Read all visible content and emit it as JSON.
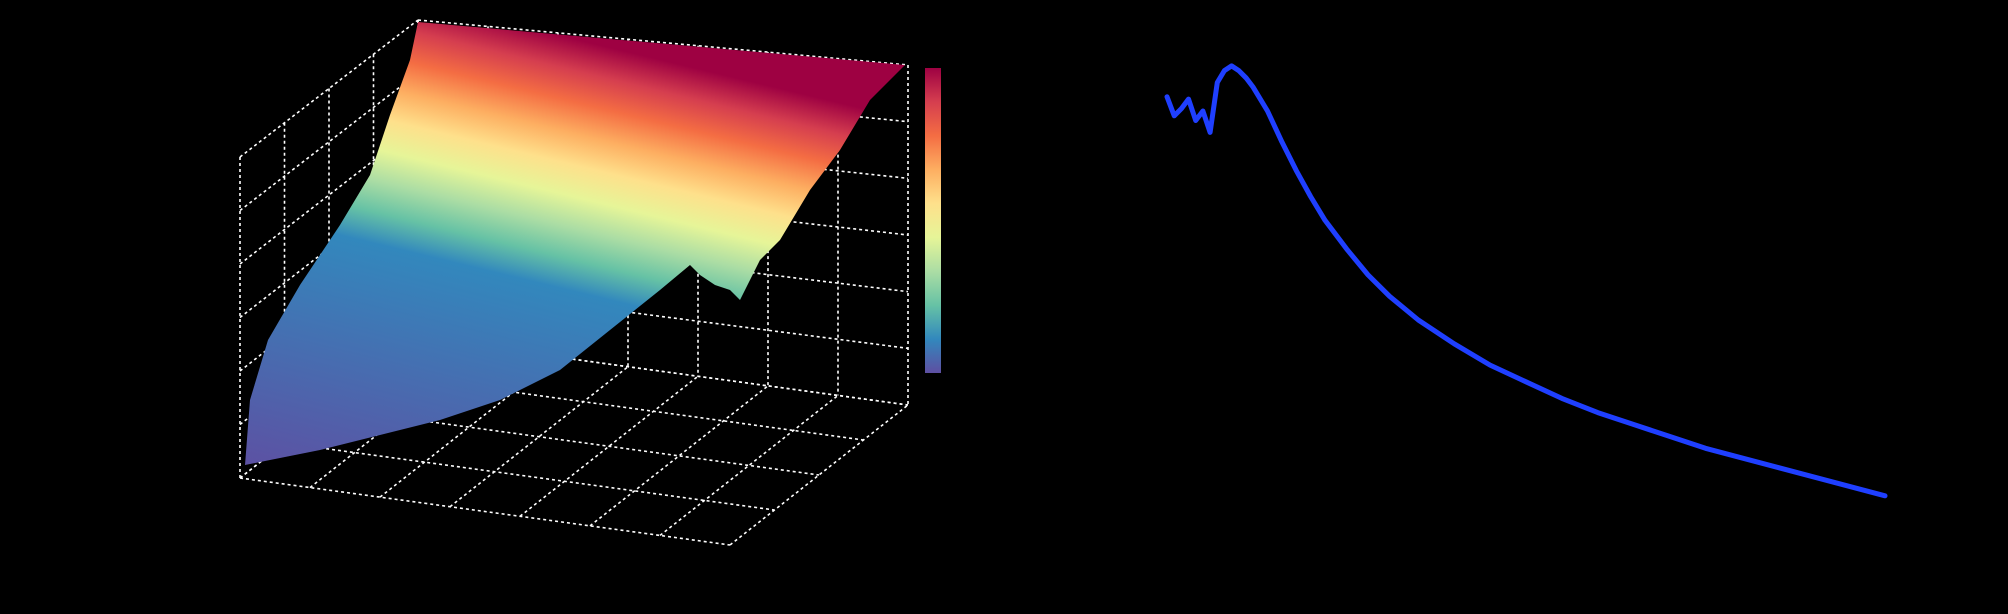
{
  "background": "#000000",
  "chart_data": [
    {
      "type": "surface3d",
      "title": "",
      "xlabel": "",
      "ylabel": "",
      "zlabel": "",
      "colormap": "Spectral_r",
      "colormap_stops": [
        "#5e4fa2",
        "#3288bd",
        "#66c2a5",
        "#abdda4",
        "#e6f598",
        "#fee08b",
        "#fdae61",
        "#f46d43",
        "#d53e4f",
        "#9e0142"
      ],
      "value_range": [
        0,
        1
      ],
      "grid": true,
      "grid_color": "#ffffff",
      "grid_style": "dashed",
      "colorbar": true,
      "colorbar_position": "right"
    },
    {
      "type": "line",
      "title": "",
      "xlabel": "",
      "ylabel": "",
      "xlim": [
        0,
        100
      ],
      "ylim": [
        0,
        1
      ],
      "grid": false,
      "series": [
        {
          "color": "#1f3fff",
          "x": [
            0,
            1,
            2,
            3,
            4,
            5,
            6,
            7,
            8,
            9,
            10,
            11,
            12,
            14,
            16,
            18,
            20,
            22,
            25,
            28,
            31,
            35,
            40,
            45,
            50,
            55,
            60,
            65,
            70,
            75,
            80,
            85,
            90,
            95,
            100
          ],
          "y": [
            0.87,
            0.83,
            0.845,
            0.865,
            0.82,
            0.84,
            0.795,
            0.9,
            0.925,
            0.935,
            0.925,
            0.91,
            0.89,
            0.84,
            0.775,
            0.715,
            0.66,
            0.61,
            0.55,
            0.495,
            0.45,
            0.4,
            0.35,
            0.305,
            0.27,
            0.235,
            0.205,
            0.18,
            0.155,
            0.13,
            0.11,
            0.09,
            0.07,
            0.05,
            0.03
          ]
        }
      ]
    }
  ]
}
